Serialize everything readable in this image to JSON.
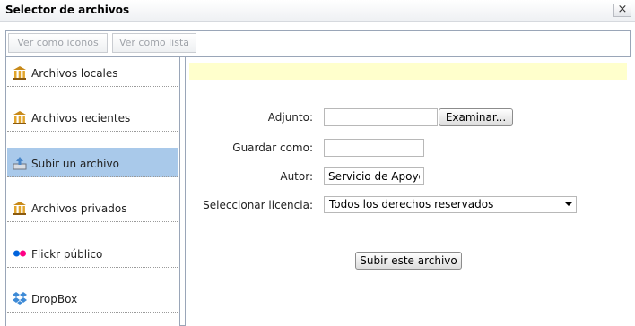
{
  "window": {
    "title": "Selector de archivos",
    "close_glyph": "×"
  },
  "toolbar": {
    "icons_view_label": "Ver como iconos",
    "list_view_label": "Ver como lista"
  },
  "sidebar": {
    "items": [
      {
        "label": "Archivos locales",
        "icon": "repository-icon",
        "active": false
      },
      {
        "label": "Archivos recientes",
        "icon": "repository-icon",
        "active": false
      },
      {
        "label": "Subir un archivo",
        "icon": "upload-icon",
        "active": true
      },
      {
        "label": "Archivos privados",
        "icon": "repository-icon",
        "active": false
      },
      {
        "label": "Flickr público",
        "icon": "flickr-icon",
        "active": false
      },
      {
        "label": "DropBox",
        "icon": "dropbox-icon",
        "active": false
      }
    ]
  },
  "form": {
    "attachment_label": "Adjunto:",
    "attachment_value": "",
    "browse_label": "Examinar...",
    "save_as_label": "Guardar como:",
    "save_as_value": "",
    "author_label": "Autor:",
    "author_value": "Servicio de Apoyo a",
    "license_label": "Seleccionar licencia:",
    "license_value": "Todos los derechos reservados",
    "submit_label": "Subir este archivo"
  },
  "colors": {
    "active_item": "#a9c9ea",
    "notice_bg": "#ffffcc",
    "border": "#9aa6b8"
  }
}
